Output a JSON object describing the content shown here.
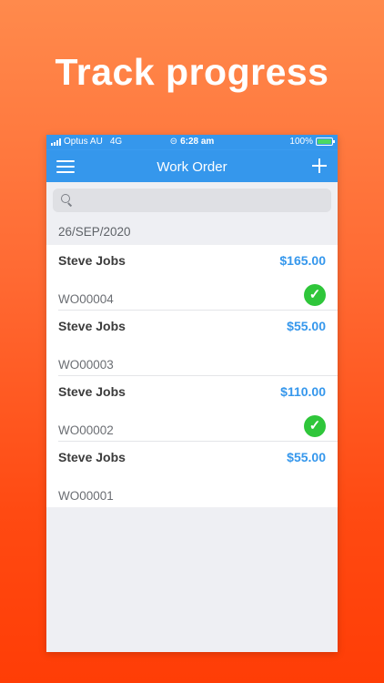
{
  "promo": {
    "headline": "Track progress"
  },
  "status_bar": {
    "carrier": "Optus AU",
    "network": "4G",
    "time": "6:28 am",
    "battery": "100%",
    "bar_color": "#3597ec"
  },
  "nav": {
    "title": "Work Order",
    "menu_icon": "hamburger-menu-icon",
    "add_icon": "plus-icon"
  },
  "search": {
    "placeholder": ""
  },
  "section": {
    "date": "26/SEP/2020"
  },
  "orders": [
    {
      "customer": "Steve Jobs",
      "amount": "$165.00",
      "number": "WO00004",
      "completed": true
    },
    {
      "customer": "Steve Jobs",
      "amount": "$55.00",
      "number": "WO00003",
      "completed": false
    },
    {
      "customer": "Steve Jobs",
      "amount": "$110.00",
      "number": "WO00002",
      "completed": true
    },
    {
      "customer": "Steve Jobs",
      "amount": "$55.00",
      "number": "WO00001",
      "completed": false
    }
  ],
  "colors": {
    "accent": "#3597ec",
    "complete_badge": "#2fc63a",
    "background_top": "#ff8a4c",
    "background_bottom": "#ff3d06"
  }
}
